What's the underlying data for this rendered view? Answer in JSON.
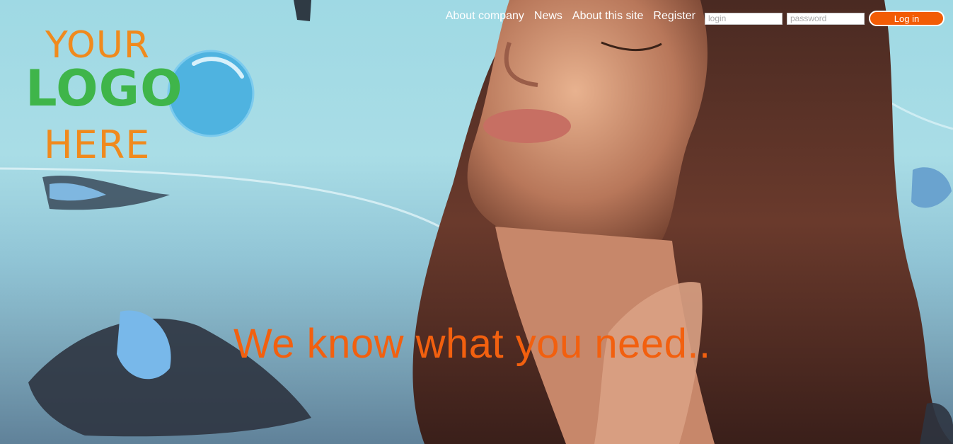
{
  "logo": {
    "line1": "YOUR",
    "line2": "LOGO",
    "line3": "HERE"
  },
  "nav": {
    "items": [
      {
        "label": "About company"
      },
      {
        "label": "News"
      },
      {
        "label": "About this site"
      },
      {
        "label": "Register"
      }
    ]
  },
  "login": {
    "login_placeholder": "login",
    "password_placeholder": "password",
    "button_label": "Log in"
  },
  "hero": {
    "tagline": "We know what you need.."
  },
  "colors": {
    "accent_orange": "#f25c05",
    "logo_orange": "#f08a1d",
    "logo_green": "#3fb54a",
    "logo_blue": "#4fb3e0",
    "sky": "#a9dde6"
  }
}
